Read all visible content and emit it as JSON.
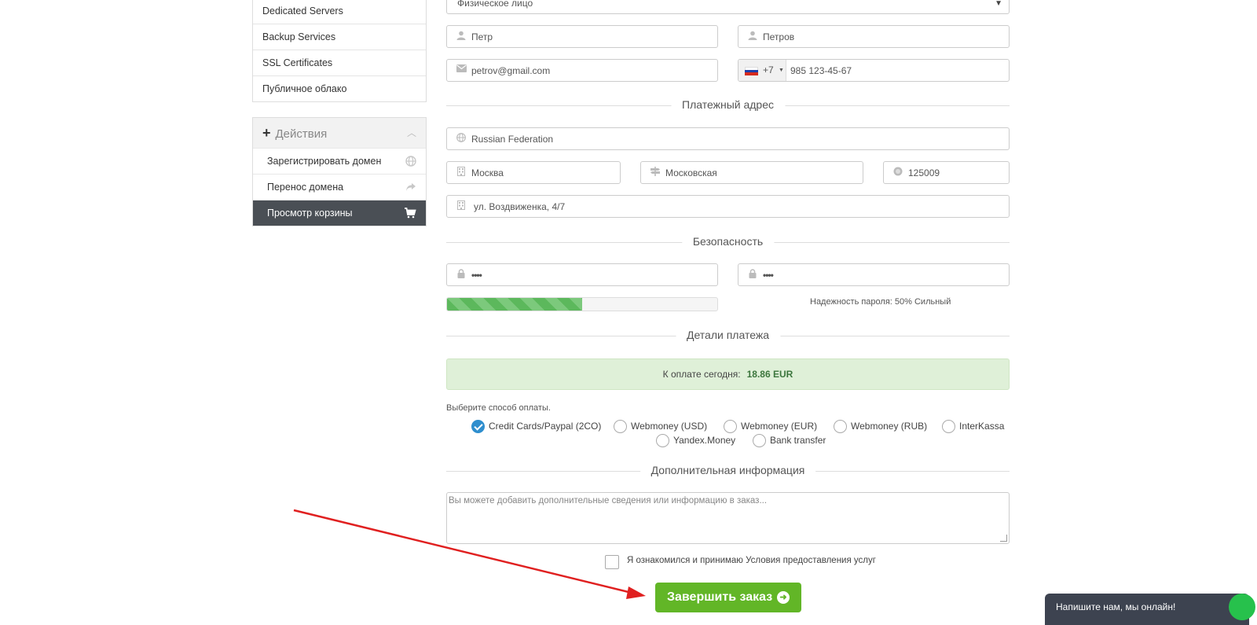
{
  "sidebar": {
    "products": [
      {
        "label": "Dedicated Servers"
      },
      {
        "label": "Backup Services"
      },
      {
        "label": "SSL Certificates"
      },
      {
        "label": "Публичное облако"
      }
    ],
    "actions": {
      "title": "Действия",
      "items": [
        {
          "label": "Зарегистрировать домен",
          "icon": "globe-icon"
        },
        {
          "label": "Перенос домена",
          "icon": "share-icon"
        },
        {
          "label": "Просмотр корзины",
          "icon": "cart-icon",
          "active": true
        }
      ]
    }
  },
  "form": {
    "account_type": "Физическое лицо",
    "first_name": "Петр",
    "last_name": "Петров",
    "email": "petrov@gmail.com",
    "phone_code": "+7",
    "phone": "985 123-45-67",
    "billing_section": "Платежный адрес",
    "country": "Russian Federation",
    "city": "Москва",
    "region": "Московская",
    "postcode": "125009",
    "address": "ул. Воздвиженка, 4/7",
    "security_section": "Безопасность",
    "password": "••••",
    "password_confirm": "••••",
    "password_strength_text": "Надежность пароля: 50% Сильный",
    "password_strength_fraction": 0.5,
    "payment_section": "Детали платежа",
    "due_label": "К оплате сегодня:",
    "due_amount": "18.86 EUR",
    "payment_method_label": "Выберите способ оплаты.",
    "payment_methods": [
      {
        "label": "Credit Cards/Paypal (2CO)",
        "selected": true
      },
      {
        "label": "Webmoney (USD)",
        "selected": false
      },
      {
        "label": "Webmoney (EUR)",
        "selected": false
      },
      {
        "label": "Webmoney (RUB)",
        "selected": false
      },
      {
        "label": "InterKassa",
        "selected": false
      },
      {
        "label": "Yandex.Money",
        "selected": false
      },
      {
        "label": "Bank transfer",
        "selected": false
      }
    ],
    "additional_section": "Дополнительная информация",
    "notes_placeholder": "Вы можете добавить дополнительные сведения или информацию в заказ...",
    "tos_text": "Я ознакомился и принимаю Условия предоставления услуг",
    "submit_label": "Завершить заказ"
  },
  "chat": {
    "label": "Напишите нам, мы онлайн!"
  },
  "colors": {
    "accent_green": "#62b627",
    "annotation_red": "#e02020",
    "active_sidebar": "#4a4f55"
  }
}
